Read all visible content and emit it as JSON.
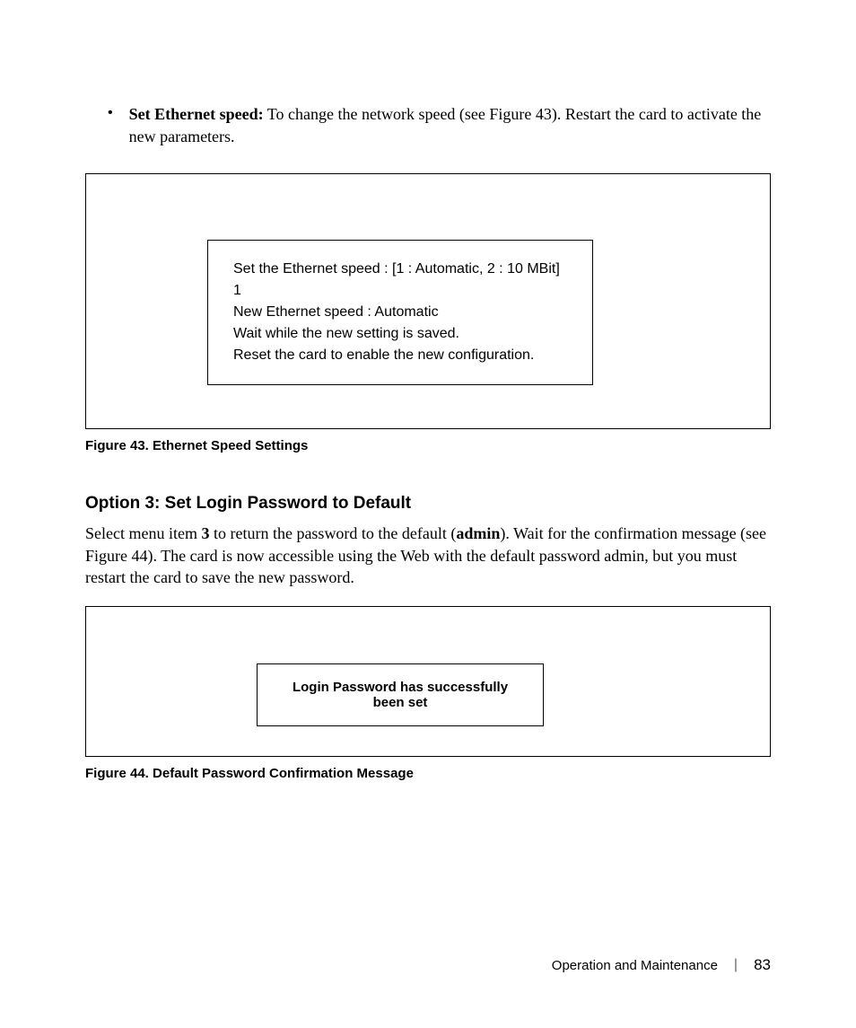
{
  "bullet": {
    "label": "Set Ethernet speed:",
    "text": " To change the network speed (see Figure 43). Restart the card to activate the new parameters."
  },
  "terminal": {
    "line1": "Set the Ethernet speed : [1 : Automatic, 2 : 10 MBit]",
    "line2": "1",
    "line3": "New Ethernet speed : Automatic",
    "line4": "Wait while the new setting is saved.",
    "line5": "Reset the card to enable the new configuration."
  },
  "caption1": "Figure 43. Ethernet Speed Settings",
  "heading": "Option 3: Set Login Password to Default",
  "para": {
    "pre": "Select menu item ",
    "bold1": "3",
    "mid": " to return the password to the default (",
    "bold2": "admin",
    "post": "). Wait for the confirmation message (see Figure 44). The card is now accessible using the Web with the default password admin, but you must restart the card to save the new password."
  },
  "confirm": "Login Password has successfully been set",
  "caption2": "Figure 44. Default Password Confirmation Message",
  "footer": {
    "section": "Operation and Maintenance",
    "page": "83"
  }
}
